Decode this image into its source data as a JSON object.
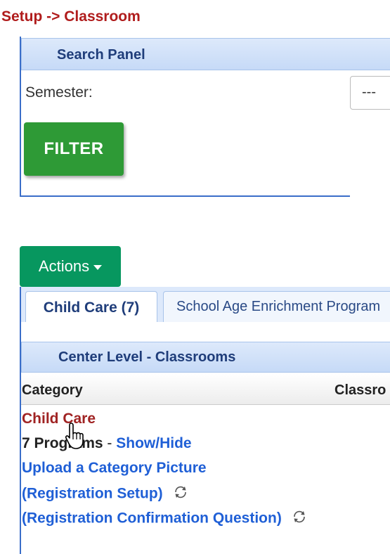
{
  "breadcrumb": "Setup -> Classroom",
  "search_panel": {
    "title": "Search Panel",
    "semester_label": "Semester:",
    "semester_value": "---",
    "filter_button": "FILTER"
  },
  "actions_button": "Actions",
  "tabs": [
    {
      "label": "Child Care (7)",
      "active": true
    },
    {
      "label": "School Age Enrichment Program",
      "active": false
    }
  ],
  "section_title": "Center Level - Classrooms",
  "table": {
    "headers": [
      "Category",
      "Classro"
    ],
    "category": {
      "name": "Child Care",
      "programs_count": "7 Programs",
      "separator": " - ",
      "show_hide": "Show/Hide",
      "upload_picture": "Upload a Category Picture",
      "registration_setup": "(Registration Setup)",
      "registration_confirmation": "(Registration Confirmation Question)"
    }
  },
  "icons": {
    "refresh": "refresh-icon",
    "cursor": "hand-pointer-icon",
    "caret": "caret-down-icon"
  }
}
